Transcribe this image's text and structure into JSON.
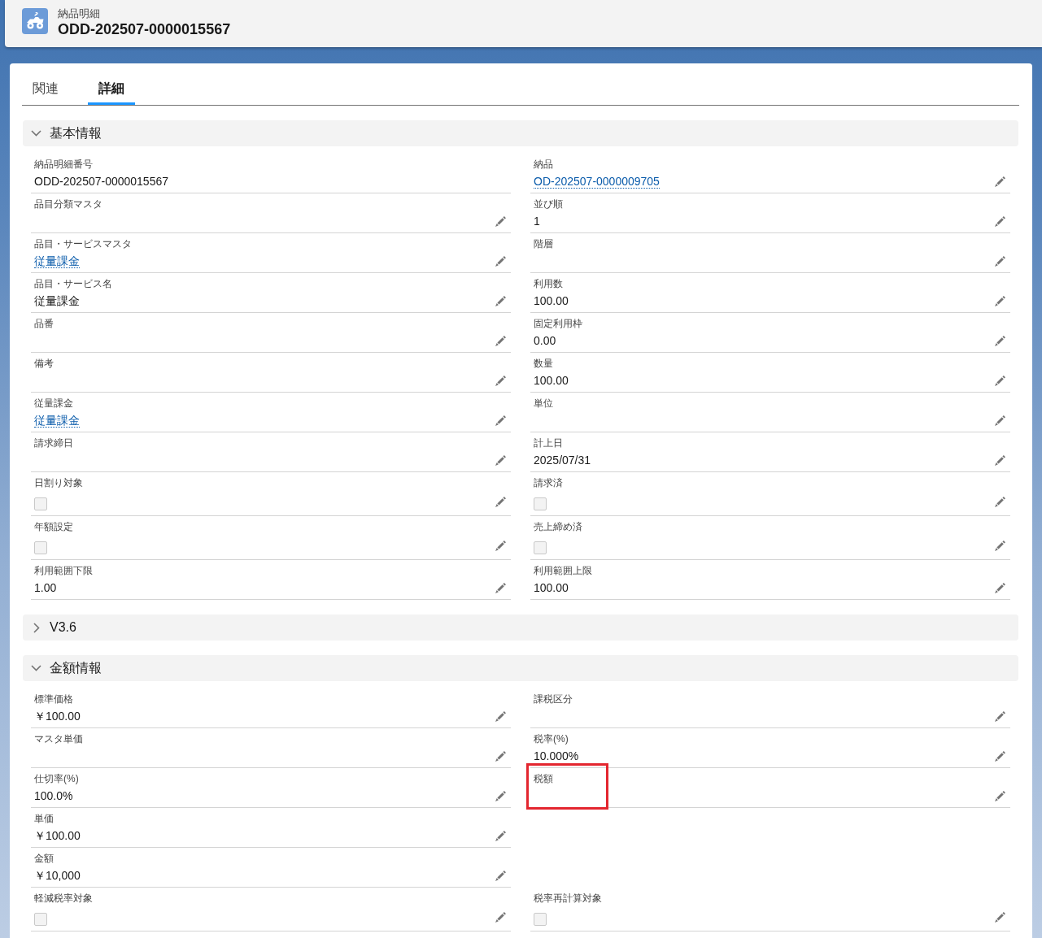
{
  "header": {
    "object_label": "納品明細",
    "title": "ODD-202507-0000015567"
  },
  "tabs": [
    {
      "label": "関連",
      "selected": false
    },
    {
      "label": "詳細",
      "selected": true
    }
  ],
  "sections": [
    {
      "title": "基本情報",
      "expanded": true,
      "rows": [
        {
          "left": {
            "label": "納品明細番号",
            "kind": "text",
            "value": "ODD-202507-0000015567",
            "editable": false,
            "highlighted": false
          },
          "right": {
            "label": "納品",
            "kind": "link",
            "value": "OD-202507-0000009705",
            "editable": true,
            "highlighted": false
          }
        },
        {
          "left": {
            "label": "品目分類マスタ",
            "kind": "text",
            "editable": true,
            "highlighted": false
          },
          "right": {
            "label": "並び順",
            "kind": "text",
            "value": "1",
            "editable": true,
            "highlighted": false
          }
        },
        {
          "left": {
            "label": "品目・サービスマスタ",
            "kind": "link",
            "value": "従量課金",
            "editable": true,
            "highlighted": false
          },
          "right": {
            "label": "階層",
            "kind": "text",
            "editable": true,
            "highlighted": false
          }
        },
        {
          "left": {
            "label": "品目・サービス名",
            "kind": "text",
            "value": "従量課金",
            "editable": true,
            "highlighted": false
          },
          "right": {
            "label": "利用数",
            "kind": "text",
            "value": "100.00",
            "editable": true,
            "highlighted": false
          }
        },
        {
          "left": {
            "label": "品番",
            "kind": "text",
            "editable": true,
            "highlighted": false
          },
          "right": {
            "label": "固定利用枠",
            "kind": "text",
            "value": "0.00",
            "editable": true,
            "highlighted": false
          }
        },
        {
          "left": {
            "label": "備考",
            "kind": "text",
            "editable": true,
            "highlighted": false
          },
          "right": {
            "label": "数量",
            "kind": "text",
            "value": "100.00",
            "editable": true,
            "highlighted": false
          }
        },
        {
          "left": {
            "label": "従量課金",
            "kind": "link",
            "value": "従量課金",
            "editable": true,
            "highlighted": false
          },
          "right": {
            "label": "単位",
            "kind": "text",
            "editable": true,
            "highlighted": false
          }
        },
        {
          "left": {
            "label": "請求締日",
            "kind": "text",
            "editable": true,
            "highlighted": false
          },
          "right": {
            "label": "計上日",
            "kind": "text",
            "value": "2025/07/31",
            "editable": true,
            "highlighted": false
          }
        },
        {
          "left": {
            "label": "日割り対象",
            "kind": "checkbox",
            "checked": false,
            "editable": true,
            "highlighted": false
          },
          "right": {
            "label": "請求済",
            "kind": "checkbox",
            "checked": false,
            "editable": true,
            "highlighted": false
          }
        },
        {
          "left": {
            "label": "年額設定",
            "kind": "checkbox",
            "checked": false,
            "editable": true,
            "highlighted": false
          },
          "right": {
            "label": "売上締め済",
            "kind": "checkbox",
            "checked": false,
            "editable": true,
            "highlighted": false
          }
        },
        {
          "left": {
            "label": "利用範囲下限",
            "kind": "text",
            "value": "1.00",
            "editable": true,
            "highlighted": false
          },
          "right": {
            "label": "利用範囲上限",
            "kind": "text",
            "value": "100.00",
            "editable": true,
            "highlighted": false
          }
        }
      ]
    },
    {
      "title": "V3.6",
      "expanded": false
    },
    {
      "title": "金額情報",
      "expanded": true,
      "rows": [
        {
          "left": {
            "label": "標準価格",
            "kind": "text",
            "value": "￥100.00",
            "editable": true,
            "highlighted": false
          },
          "right": {
            "label": "課税区分",
            "kind": "text",
            "editable": true,
            "highlighted": false
          }
        },
        {
          "left": {
            "label": "マスタ単価",
            "kind": "text",
            "editable": true,
            "highlighted": false
          },
          "right": {
            "label": "税率(%)",
            "kind": "text",
            "value": "10.000%",
            "editable": true,
            "highlighted": false
          }
        },
        {
          "left": {
            "label": "仕切率(%)",
            "kind": "text",
            "value": "100.0%",
            "editable": true,
            "highlighted": false
          },
          "right": {
            "label": "税額",
            "kind": "text",
            "editable": true,
            "highlighted": true
          }
        },
        {
          "left": {
            "label": "単価",
            "kind": "text",
            "value": "￥100.00",
            "editable": true,
            "highlighted": false
          }
        },
        {
          "left": {
            "label": "金額",
            "kind": "text",
            "value": "￥10,000",
            "editable": true,
            "highlighted": false
          }
        },
        {
          "left": {
            "label": "軽減税率対象",
            "kind": "checkbox",
            "checked": false,
            "editable": true,
            "highlighted": false
          },
          "right": {
            "label": "税率再計算対象",
            "kind": "checkbox",
            "checked": false,
            "editable": true,
            "highlighted": false
          }
        }
      ]
    }
  ]
}
